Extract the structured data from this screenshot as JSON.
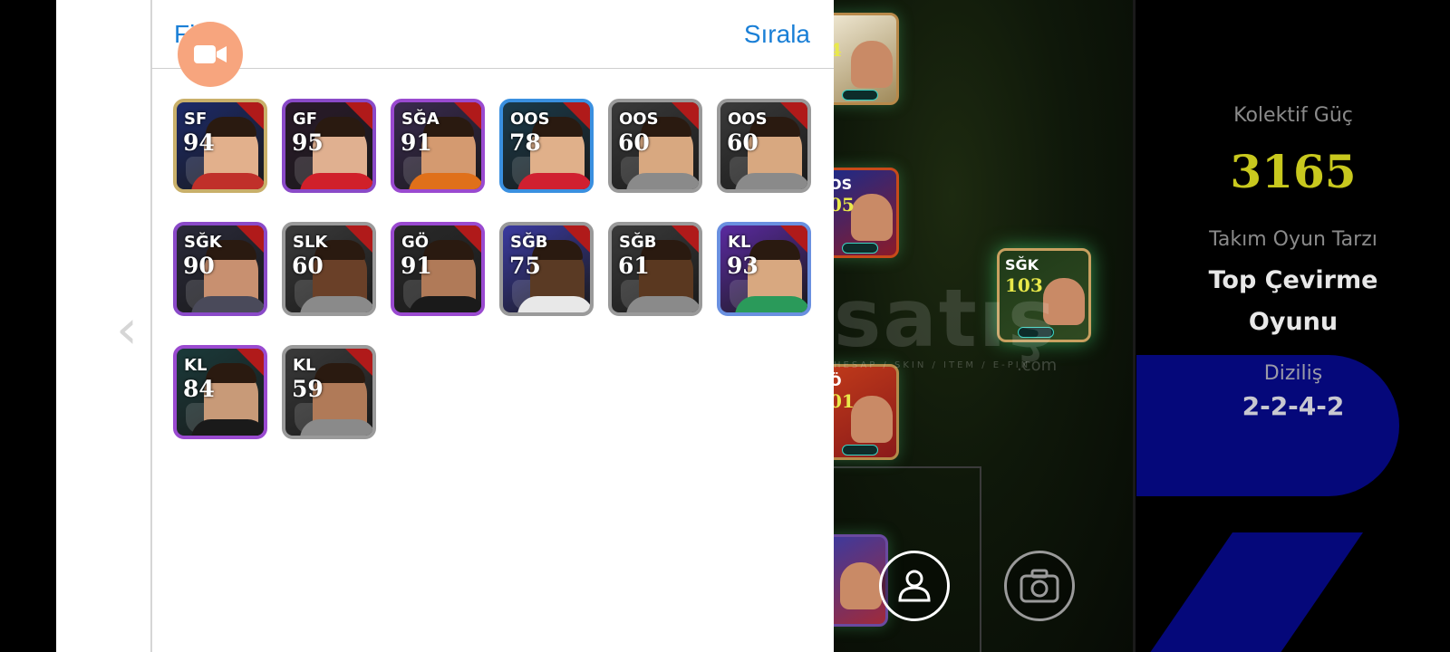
{
  "header": {
    "filter_label": "Filtre",
    "sort_label": "Sırala"
  },
  "back_chevron": "‹",
  "players": [
    {
      "pos": "SF",
      "rating": "94",
      "frame": "#c9b06a",
      "bg": "#1c2a6a",
      "skin": "#e2b08c",
      "shirt": "#c0302a"
    },
    {
      "pos": "GF",
      "rating": "95",
      "frame": "#8a4ac8",
      "bg": "#2a1a2a",
      "skin": "#e0b090",
      "shirt": "#d0202a"
    },
    {
      "pos": "SĞA",
      "rating": "91",
      "frame": "#9a4ad0",
      "bg": "#3a2a50",
      "skin": "#d49a70",
      "shirt": "#e0701a"
    },
    {
      "pos": "OOS",
      "rating": "78",
      "frame": "#3a90e0",
      "bg": "#1a3a4a",
      "skin": "#e0b08a",
      "shirt": "#d02030"
    },
    {
      "pos": "OOS",
      "rating": "60",
      "frame": "#9a9a9a",
      "bg": "#3a3a3a",
      "skin": "#d8a880",
      "shirt": "#8a8a8a"
    },
    {
      "pos": "OOS",
      "rating": "60",
      "frame": "#9a9a9a",
      "bg": "#3a3a3a",
      "skin": "#d8a880",
      "shirt": "#8a8a8a"
    },
    {
      "pos": "SĞK",
      "rating": "90",
      "frame": "#8a4ac8",
      "bg": "#2a2a3a",
      "skin": "#c89070",
      "shirt": "#4a4a5a"
    },
    {
      "pos": "SLK",
      "rating": "60",
      "frame": "#9a9a9a",
      "bg": "#3a3a3a",
      "skin": "#6a4028",
      "shirt": "#8a8a8a"
    },
    {
      "pos": "GÖ",
      "rating": "91",
      "frame": "#9a4ad0",
      "bg": "#2a2a2a",
      "skin": "#b07a58",
      "shirt": "#1a1a1a"
    },
    {
      "pos": "SĞB",
      "rating": "75",
      "frame": "#9a9a9a",
      "bg": "#3a3aa0",
      "skin": "#5a3a24",
      "shirt": "#e8e8e8"
    },
    {
      "pos": "SĞB",
      "rating": "61",
      "frame": "#9a9a9a",
      "bg": "#3a3a3a",
      "skin": "#5a3820",
      "shirt": "#8a8a8a"
    },
    {
      "pos": "KL",
      "rating": "93",
      "frame": "#6a90e0",
      "bg": "#5a2aa0",
      "skin": "#d8a880",
      "shirt": "#2a9a5a"
    },
    {
      "pos": "KL",
      "rating": "84",
      "frame": "#9a4ad0",
      "bg": "#1a3a3a",
      "skin": "#c89a78",
      "shirt": "#1a1a1a"
    },
    {
      "pos": "KL",
      "rating": "59",
      "frame": "#9a9a9a",
      "bg": "#3a3a3a",
      "skin": "#b07a58",
      "shirt": "#8a8a8a"
    }
  ],
  "field_cards": [
    {
      "pos": "",
      "rating": "4"
    },
    {
      "pos": "OS",
      "rating": "05"
    },
    {
      "pos": "SĞK",
      "rating": "103"
    },
    {
      "pos": "Ö",
      "rating": "01"
    },
    {
      "pos": "",
      "rating": ""
    }
  ],
  "watermark": {
    "main": "satış",
    "sub": "HESAP / SKIN / ITEM / E-PIN",
    "com": ".com"
  },
  "info": {
    "collective_label": "Kolektif Güç",
    "collective_value": "3165",
    "style_label": "Takım Oyun Tarzı",
    "style_value": "Top Çevirme Oyunu",
    "formation_label": "Diziliş",
    "formation_value": "2-2-4-2"
  },
  "colors": {
    "accent": "#1a7fd6",
    "power": "#c8c81e",
    "panel_blue": "#05087a"
  },
  "icons": {
    "record": "video-camera-icon",
    "avatar": "person-icon",
    "camera": "camera-icon"
  }
}
